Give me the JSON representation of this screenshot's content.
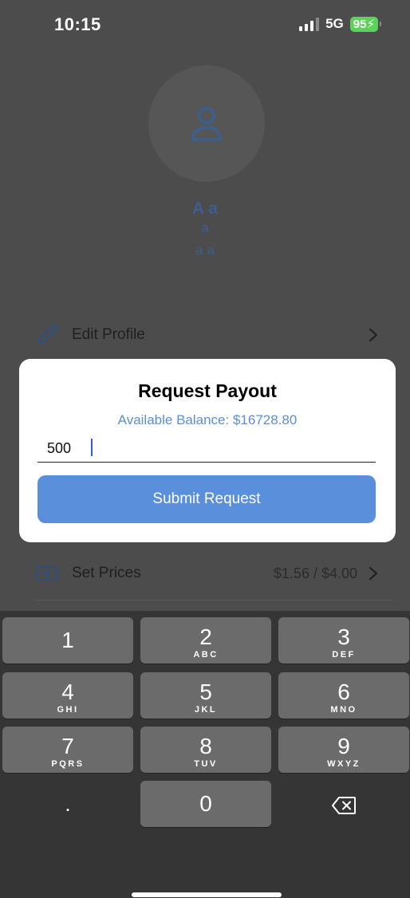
{
  "status_bar": {
    "time": "10:15",
    "network": "5G",
    "battery": "95"
  },
  "profile": {
    "name": "A a",
    "line2": "a",
    "line3": "a a"
  },
  "rows": [
    {
      "label": "Edit Profile",
      "icon": "pencil-icon"
    },
    {
      "label": "Set Prices",
      "value": "$1.56 / $4.00",
      "icon": "money-icon"
    }
  ],
  "modal": {
    "title": "Request Payout",
    "balance": "Available Balance: $16728.80",
    "amount_value": "500",
    "submit_label": "Submit Request"
  },
  "keyboard": {
    "keys": [
      {
        "digit": "1",
        "letters": ""
      },
      {
        "digit": "2",
        "letters": "ABC"
      },
      {
        "digit": "3",
        "letters": "DEF"
      },
      {
        "digit": "4",
        "letters": "GHI"
      },
      {
        "digit": "5",
        "letters": "JKL"
      },
      {
        "digit": "6",
        "letters": "MNO"
      },
      {
        "digit": "7",
        "letters": "PQRS"
      },
      {
        "digit": "8",
        "letters": "TUV"
      },
      {
        "digit": "9",
        "letters": "WXYZ"
      },
      {
        "digit": "0",
        "letters": ""
      }
    ],
    "decimal": ".",
    "backspace_icon": "backspace-icon"
  },
  "colors": {
    "accent": "#5a8fdc",
    "balance_text": "#5a8fd4",
    "battery": "#5bd25a"
  }
}
